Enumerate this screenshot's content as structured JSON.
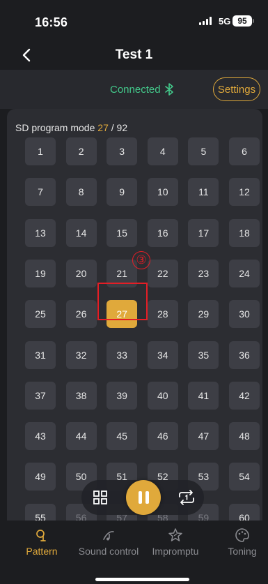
{
  "status_bar": {
    "time": "16:56",
    "network": "5G",
    "battery": "95"
  },
  "header": {
    "title": "Test 1"
  },
  "connection": {
    "status": "Connected",
    "settings_label": "Settings"
  },
  "mode": {
    "label": "SD program mode",
    "current": "27",
    "separator": "/",
    "total": "92"
  },
  "programs": [
    "1",
    "2",
    "3",
    "4",
    "5",
    "6",
    "7",
    "8",
    "9",
    "10",
    "11",
    "12",
    "13",
    "14",
    "15",
    "16",
    "17",
    "18",
    "19",
    "20",
    "21",
    "22",
    "23",
    "24",
    "25",
    "26",
    "27",
    "28",
    "29",
    "30",
    "31",
    "32",
    "33",
    "34",
    "35",
    "36",
    "37",
    "38",
    "39",
    "40",
    "41",
    "42",
    "43",
    "44",
    "45",
    "46",
    "47",
    "48",
    "49",
    "50",
    "51",
    "52",
    "53",
    "54",
    "55",
    "56",
    "57",
    "58",
    "59",
    "60"
  ],
  "selected_program": "27",
  "annotation": {
    "marker": "③"
  },
  "tabs": [
    {
      "label": "Pattern",
      "icon": "pattern-icon",
      "active": true
    },
    {
      "label": "Sound control",
      "icon": "sound-control-icon",
      "active": false
    },
    {
      "label": "Impromptu",
      "icon": "impromptu-icon",
      "active": false
    },
    {
      "label": "Toning",
      "icon": "palette-icon",
      "active": false
    }
  ],
  "colors": {
    "accent": "#e0a93b",
    "connected": "#43c98b",
    "annotation": "#e41e26",
    "background": "#1c1d20",
    "panel": "#2c2d32",
    "cell": "#3d3e45"
  }
}
